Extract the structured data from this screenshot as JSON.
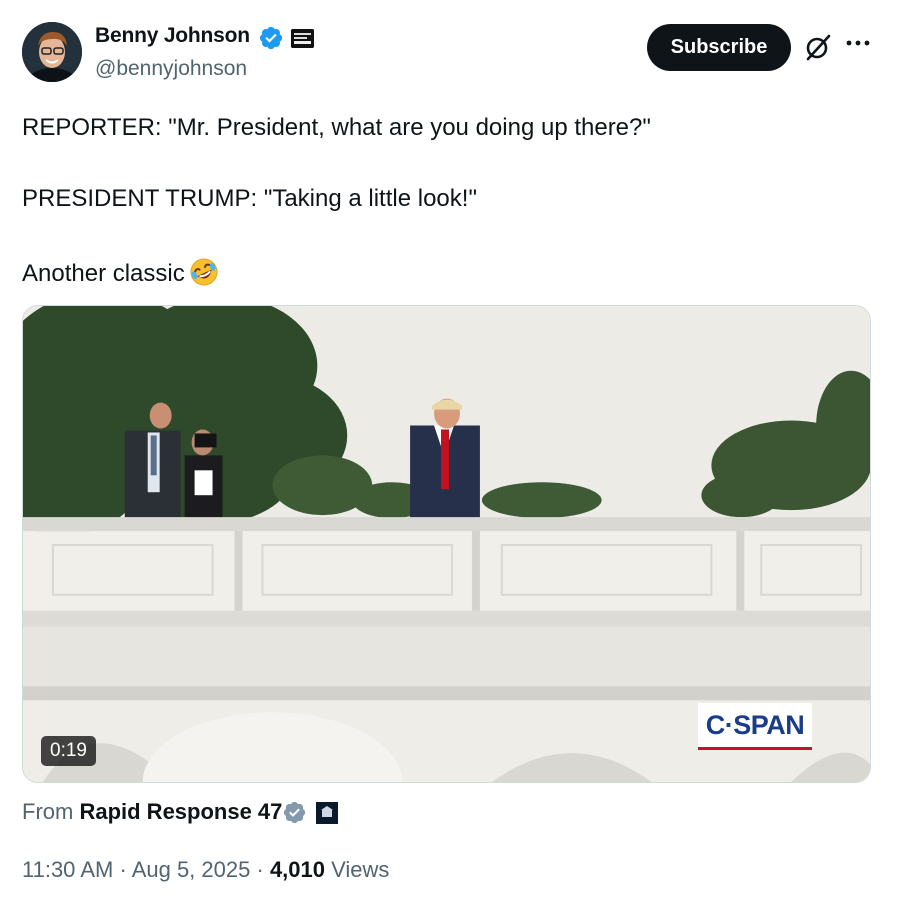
{
  "author": {
    "name": "Benny Johnson",
    "handle": "@bennyjohnson"
  },
  "actions": {
    "subscribe_label": "Subscribe"
  },
  "tweet": {
    "lines": [
      "REPORTER: \"Mr. President, what are you doing up there?\"",
      "PRESIDENT TRUMP: \"Taking a little look!\"",
      "Another classic"
    ],
    "emoji": "rolling-on-floor-laughing"
  },
  "media": {
    "duration": "0:19",
    "watermark": "C·SPAN"
  },
  "source": {
    "prefix": "From",
    "name": "Rapid Response 47"
  },
  "meta": {
    "time": "11:30 AM",
    "separator": "·",
    "date": "Aug 5, 2025",
    "views_count": "4,010",
    "views_label": "Views"
  },
  "colors": {
    "verified": "#1d9bf0",
    "source_verified": "#829aab",
    "secondary_text": "#536471",
    "primary_text": "#0f1419",
    "cspan_blue": "#1b3b8b"
  }
}
